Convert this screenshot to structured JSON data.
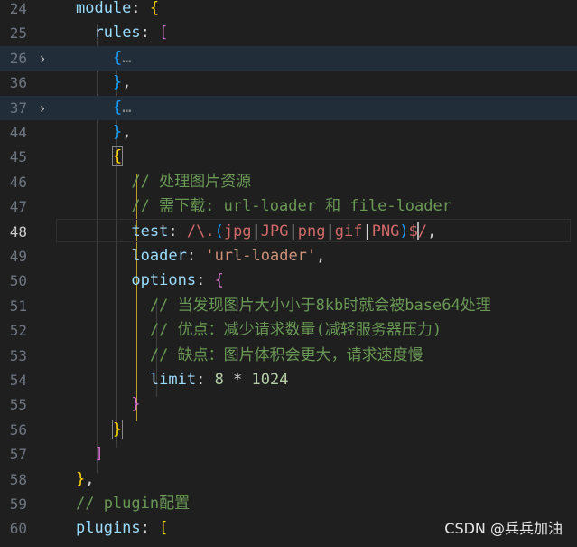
{
  "editor": {
    "language": "javascript",
    "current_line": "48",
    "lines": [
      {
        "n": "24",
        "code": "module: {"
      },
      {
        "n": "25",
        "code": "  rules: ["
      },
      {
        "n": "26",
        "code": "    {…",
        "folded": true
      },
      {
        "n": "36",
        "code": "    },"
      },
      {
        "n": "37",
        "code": "    {…",
        "folded": true
      },
      {
        "n": "44",
        "code": "    },"
      },
      {
        "n": "45",
        "code": "    {"
      },
      {
        "n": "46",
        "code": "      // 处理图片资源"
      },
      {
        "n": "47",
        "code": "      // 需下载: url-loader 和 file-loader"
      },
      {
        "n": "48",
        "code": "      test: /\\.(jpg|JPG|png|gif|PNG)$/,"
      },
      {
        "n": "49",
        "code": "      loader: 'url-loader',"
      },
      {
        "n": "50",
        "code": "      options: {"
      },
      {
        "n": "51",
        "code": "        // 当发现图片大小小于8kb时就会被base64处理"
      },
      {
        "n": "52",
        "code": "        // 优点：减少请求数量(减轻服务器压力)"
      },
      {
        "n": "53",
        "code": "        // 缺点：图片体积会更大，请求速度慢"
      },
      {
        "n": "54",
        "code": "        limit: 8 * 1024"
      },
      {
        "n": "55",
        "code": "      }"
      },
      {
        "n": "56",
        "code": "    }"
      },
      {
        "n": "57",
        "code": "  ]"
      },
      {
        "n": "58",
        "code": "},"
      },
      {
        "n": "59",
        "code": "// plugin配置"
      },
      {
        "n": "60",
        "code": "plugins: ["
      }
    ]
  },
  "fold_icon": "chevron-right-icon",
  "folded_ellipsis": "…",
  "watermark": "CSDN @兵兵加油",
  "colors": {
    "background": "#1f1f1f",
    "folded_line_highlight": "#222d3a",
    "property": "#9cdcfe",
    "bracket_level1": "#ffd700",
    "bracket_level2": "#da70d6",
    "bracket_level3": "#179fff",
    "comment": "#6a9955",
    "string": "#ce9178",
    "number": "#b5cea8",
    "regex": "#d16969",
    "active_indent_guide": "#b9a020"
  }
}
